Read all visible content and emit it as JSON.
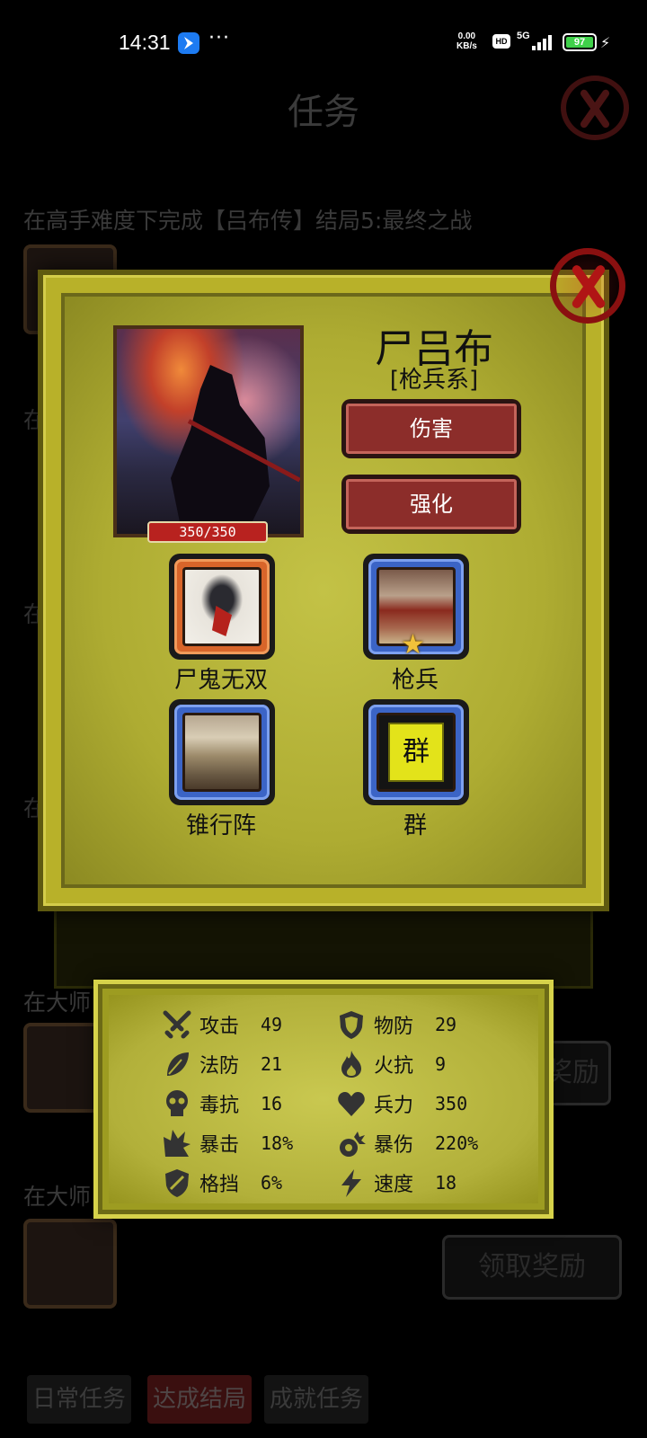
{
  "status_bar": {
    "time": "14:31",
    "dots": "···",
    "net_speed_value": "0.00",
    "net_speed_unit": "KB/s",
    "hd": "HD",
    "network": "5G",
    "battery": "97"
  },
  "background": {
    "title": "任务",
    "task_text_top": "在高手难度下完成【吕布传】结局5:最终之战",
    "task_text_mid": "在大师",
    "task_text_low": "在大师",
    "partial_char": "在",
    "claim_button_label": "领取奖励",
    "claim_button_partial": "奖励",
    "tabs": [
      {
        "label": "日常任务",
        "active": false
      },
      {
        "label": "达成结局",
        "active": true
      },
      {
        "label": "成就任务",
        "active": false
      }
    ]
  },
  "hero": {
    "name": "尸吕布",
    "class": "[枪兵系]",
    "hp": "350/350",
    "buttons": {
      "damage": "伤害",
      "enhance": "强化"
    }
  },
  "skills": [
    {
      "label": "尸鬼无双",
      "frame": "orange",
      "art": "ghost"
    },
    {
      "label": "枪兵",
      "frame": "blue",
      "art": "army",
      "star": true
    },
    {
      "label": "锥行阵",
      "frame": "blue",
      "art": "camp"
    },
    {
      "label": "群",
      "frame": "blue",
      "art": "flag",
      "banner_text": "群"
    }
  ],
  "stats": [
    {
      "label": "攻击",
      "value": "49",
      "icon": "crossed-swords-icon"
    },
    {
      "label": "物防",
      "value": "29",
      "icon": "shield-icon"
    },
    {
      "label": "法防",
      "value": "21",
      "icon": "leaf-icon"
    },
    {
      "label": "火抗",
      "value": "9",
      "icon": "flame-icon"
    },
    {
      "label": "毒抗",
      "value": "16",
      "icon": "skull-icon"
    },
    {
      "label": "兵力",
      "value": "350",
      "icon": "heart-icon"
    },
    {
      "label": "暴击",
      "value": "18%",
      "icon": "burst-icon"
    },
    {
      "label": "暴伤",
      "value": "220%",
      "icon": "explosion-icon"
    },
    {
      "label": "格挡",
      "value": "6%",
      "icon": "block-shield-icon"
    },
    {
      "label": "速度",
      "value": "18",
      "icon": "lightning-icon"
    }
  ],
  "colors": {
    "panel": "#b8b129",
    "button_red": "#8c2d2a",
    "frame_orange": "#d8652a",
    "frame_blue": "#3b64c6",
    "hp_red": "#b8221f"
  }
}
